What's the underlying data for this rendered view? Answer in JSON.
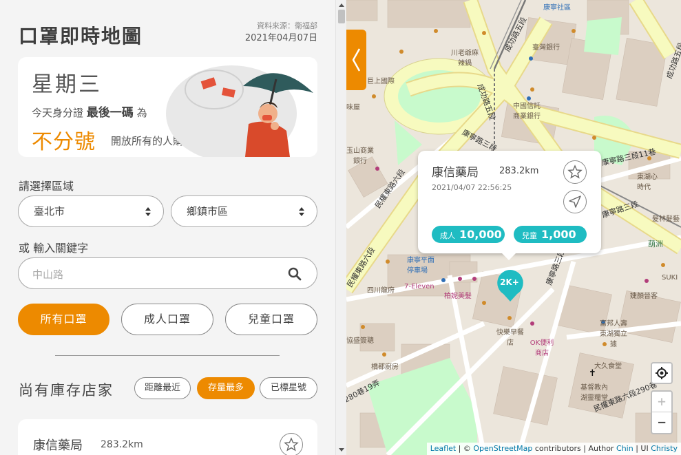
{
  "app": {
    "title": "口罩即時地圖",
    "source_label": "資料來源：衛福部",
    "date": "2021年04月07日"
  },
  "hero": {
    "weekday": "星期三",
    "rule_prefix": "今天身分證",
    "rule_bold": "最後一碼",
    "rule_suffix": "為",
    "highlight": "不分號",
    "message": "開放所有的人購買！"
  },
  "filters": {
    "region_label": "請選擇區域",
    "city": "臺北市",
    "district": "鄉鎮市區",
    "keyword_label": "或 輸入關鍵字",
    "keyword_placeholder": "中山路"
  },
  "mask_types": [
    {
      "label": "所有口罩",
      "active": true
    },
    {
      "label": "成人口罩",
      "active": false
    },
    {
      "label": "兒童口罩",
      "active": false
    }
  ],
  "list": {
    "title": "尚有庫存店家",
    "sort_options": [
      {
        "label": "距離最近",
        "active": false
      },
      {
        "label": "存量最多",
        "active": true
      },
      {
        "label": "已標星號",
        "active": false
      }
    ],
    "first_store": {
      "name": "康信藥局",
      "distance": "283.2km"
    }
  },
  "popup": {
    "name": "康信藥局",
    "distance": "283.2km",
    "updated": "2021/04/07 22:56:25",
    "adult_label": "成人",
    "adult_count": "10,000",
    "child_label": "兒童",
    "child_count": "1,000"
  },
  "map": {
    "cluster_label": "2K+",
    "zoom_in": "+",
    "zoom_out": "−",
    "streets": [
      "成功路五段",
      "成功路五段",
      "康寧路三段",
      "民權東路六段",
      "康寧路三段11巷",
      "康寧路三段",
      "民權東路六段",
      "康寧路三段",
      "成功路五段",
      "民權東路六段290巷",
      "280巷19弄"
    ],
    "places": [
      "康寧社區",
      "川老爺麻辣鍋",
      "臺灣銀行",
      "巨上國際",
      "中國信託商業銀行",
      "味屋",
      "玉山商業銀行",
      "東湖心時代",
      "髮林髮藝",
      "葫洲",
      "康寧平面停車場",
      "7-Eleven",
      "四川龍府",
      "柏妮美髮",
      "SUKI",
      "婕顏晉客",
      "快樂早餐店",
      "OK便利商店",
      "富邦人壽東湖獨立據",
      "大久食堂",
      "協盛簽聰",
      "橋都廚房",
      "基督教內湖靈糧堂"
    ],
    "attribution": {
      "leaflet": "Leaflet",
      "sep1": " | © ",
      "osm": "OpenStreetMap",
      "contributors": " contributors | Author ",
      "author": "Chin",
      "ui_sep": " | UI ",
      "ui": "Christy"
    }
  },
  "colors": {
    "accent": "#ed8a00",
    "teal": "#1fbcc2",
    "major_road": "#f7fabf",
    "park": "#c8facc"
  }
}
